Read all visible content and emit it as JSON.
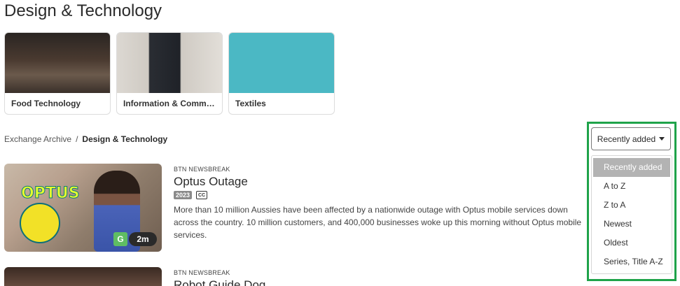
{
  "page": {
    "title": "Design & Technology"
  },
  "categories": [
    {
      "label": "Food Technology"
    },
    {
      "label": "Information & Communication Technologies"
    },
    {
      "label": "Textiles"
    }
  ],
  "breadcrumb": {
    "root": "Exchange Archive",
    "separator": "/",
    "current": "Design & Technology"
  },
  "sort": {
    "selected": "Recently added",
    "options": [
      "Recently added",
      "A to Z",
      "Z to A",
      "Newest",
      "Oldest",
      "Series, Title A-Z"
    ]
  },
  "results": [
    {
      "series": "BTN NEWSBREAK",
      "title": "Optus Outage",
      "year": "2023",
      "cc": "CC",
      "description": "More than 10 million Aussies have been affected by a nationwide outage with Optus mobile services down across the country. 10 million customers, and 400,000 businesses woke up this morning without Optus mobile services.",
      "thumb_text": "OPTUS",
      "rating": "G",
      "duration": "2m"
    },
    {
      "series": "BTN NEWSBREAK",
      "title": "Robot Guide Dog"
    }
  ],
  "colors": {
    "highlight": "#1fa34a",
    "textiles": "#4bb8c4",
    "rating_g": "#5fbd63"
  }
}
